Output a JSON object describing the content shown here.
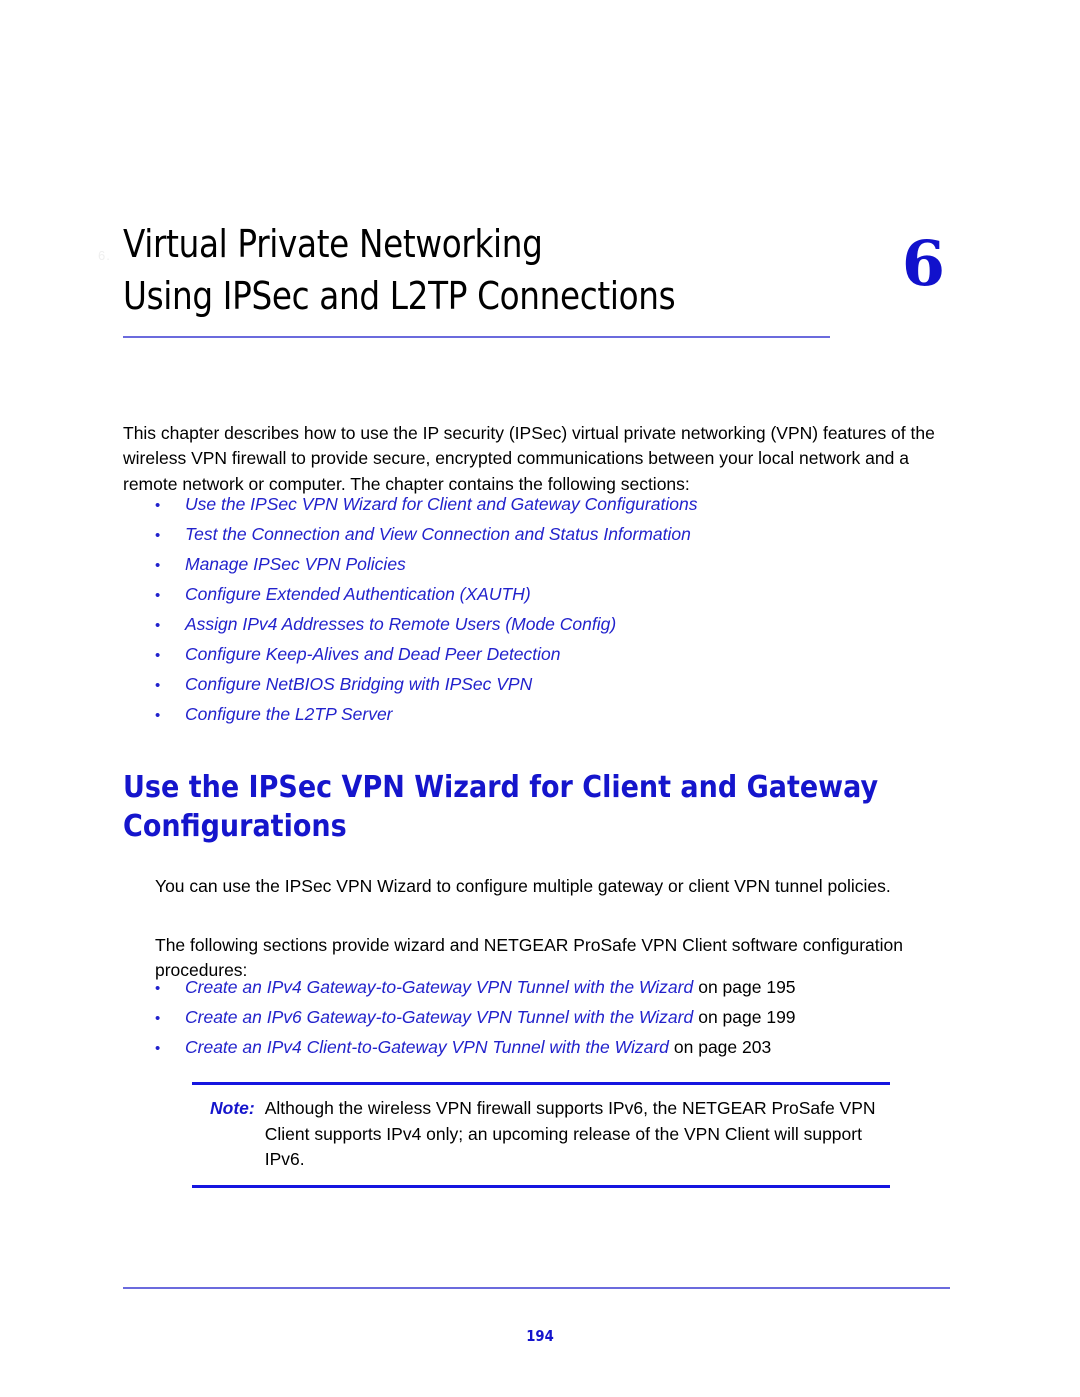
{
  "chapter": {
    "number": "6",
    "title_line1": "Virtual Private Networking",
    "title_line2": "Using IPSec and L2TP Connections",
    "ghost_marker": "6."
  },
  "intro": {
    "paragraph": "This chapter describes how to use the IP security (IPSec) virtual private networking (VPN) features of the wireless VPN firewall to provide secure, encrypted communications between your local network and a remote network or computer. The chapter contains the following sections:"
  },
  "section_links": {
    "bullet": "•",
    "items": [
      {
        "label": "Use the IPSec VPN Wizard for Client and Gateway Configurations"
      },
      {
        "label": "Test the Connection and View Connection and Status Information"
      },
      {
        "label": "Manage IPSec VPN Policies"
      },
      {
        "label": "Configure Extended Authentication (XAUTH)"
      },
      {
        "label": "Assign IPv4 Addresses to Remote Users (Mode Config)"
      },
      {
        "label": "Configure Keep-Alives and Dead Peer Detection"
      },
      {
        "label": "Configure NetBIOS Bridging with IPSec VPN"
      },
      {
        "label": "Configure the L2TP Server"
      }
    ]
  },
  "section": {
    "heading": "Use the IPSec VPN Wizard for Client and Gateway Configurations",
    "paragraph_1": "You can use the IPSec VPN Wizard to configure multiple gateway or client VPN tunnel policies.",
    "paragraph_2": "The following sections provide wizard and NETGEAR ProSafe VPN Client software configuration procedures:"
  },
  "reference_links": {
    "bullet": "•",
    "items": [
      {
        "label": "Create an IPv4 Gateway-to-Gateway VPN Tunnel with the Wizard",
        "suffix": "on page 195"
      },
      {
        "label": "Create an IPv6 Gateway-to-Gateway VPN Tunnel with the Wizard",
        "suffix": "on page 199"
      },
      {
        "label": "Create an IPv4 Client-to-Gateway VPN Tunnel with the Wizard",
        "suffix": "on page 203"
      }
    ]
  },
  "note": {
    "label": "Note:",
    "text": "Although the wireless VPN firewall supports IPv6, the NETGEAR ProSafe VPN Client supports IPv4 only; an upcoming release of the VPN Client will support IPv6."
  },
  "footer": {
    "page_number": "194"
  },
  "colors": {
    "link_blue": "#2222cc",
    "heading_blue": "#1515cc",
    "chapter_number_blue": "#1111cc",
    "rule_light_blue": "#6b6bdd",
    "note_rule_blue": "#1616e0",
    "body_black": "#000000"
  }
}
